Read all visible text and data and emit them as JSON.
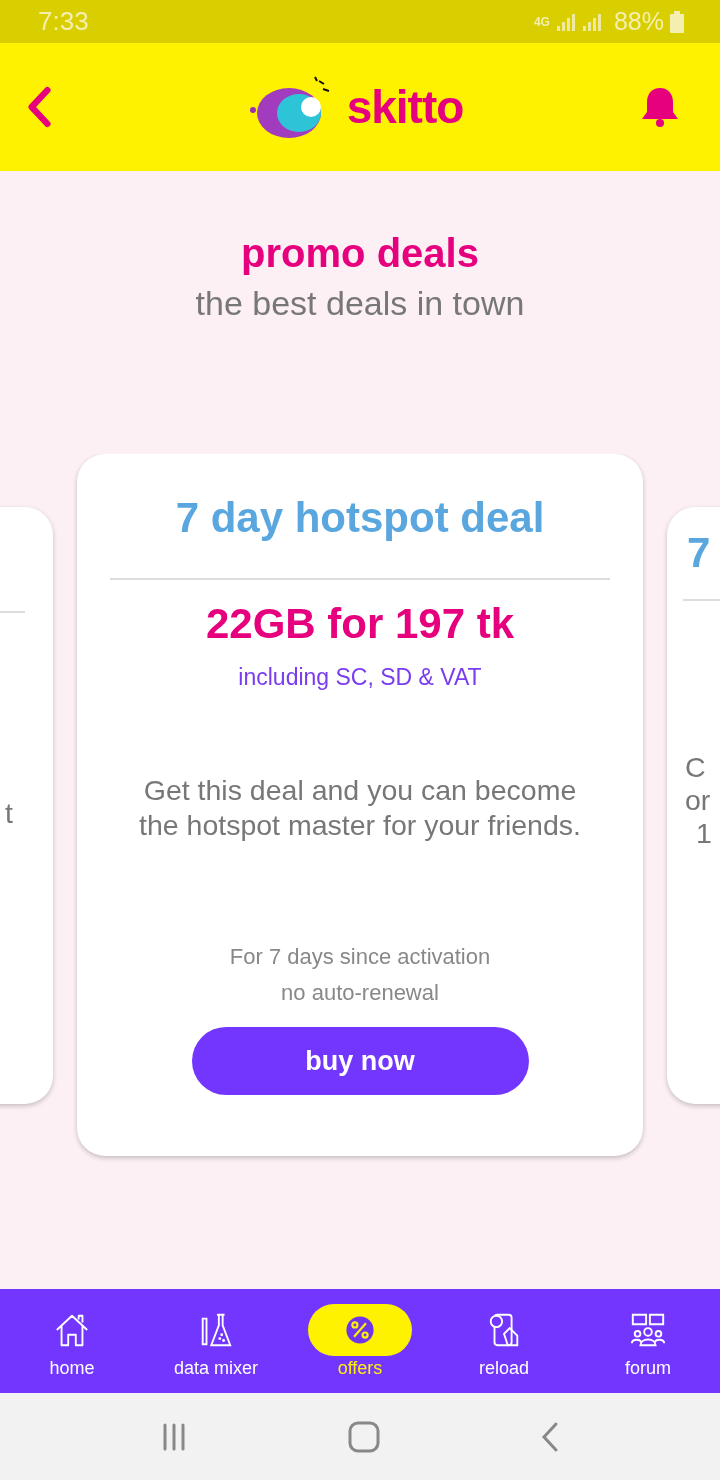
{
  "status_bar": {
    "time": "7:33",
    "network": "4G",
    "battery": "88%"
  },
  "header": {
    "logo_text": "skitto"
  },
  "intro": {
    "title": "promo deals",
    "subtitle": "the best deals in town"
  },
  "deals": [
    {
      "kind": "partial-left",
      "lines": [
        "t"
      ]
    },
    {
      "kind": "full",
      "title": "7 day hotspot deal",
      "price": "22GB for 197 tk",
      "tax_note": "including SC, SD & VAT",
      "description": "Get this deal and you can become the hotspot master for your friends.",
      "validity": [
        "For 7 days since activation",
        "no auto-renewal"
      ],
      "button": "buy now"
    },
    {
      "kind": "partial-right",
      "title": "7",
      "lines": [
        "C",
        "or",
        "1"
      ]
    }
  ],
  "nav": [
    {
      "label": "home",
      "selected": false
    },
    {
      "label": "data mixer",
      "selected": false
    },
    {
      "label": "offers",
      "selected": true
    },
    {
      "label": "reload",
      "selected": false
    },
    {
      "label": "forum",
      "selected": false
    }
  ]
}
